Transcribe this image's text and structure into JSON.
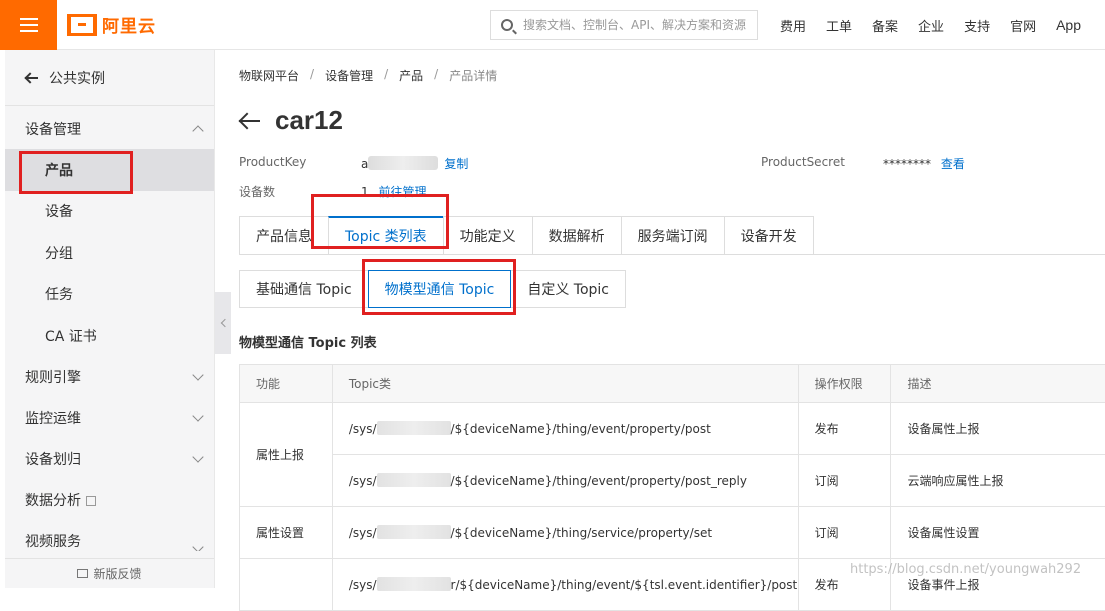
{
  "header": {
    "logo_text": "阿里云",
    "search_placeholder": "搜索文档、控制台、API、解决方案和资源",
    "nav": [
      "费用",
      "工单",
      "备案",
      "企业",
      "支持",
      "官网",
      "App"
    ]
  },
  "sidebar": {
    "back_label": "公共实例",
    "group_device": "设备管理",
    "sub_items": [
      "产品",
      "设备",
      "分组",
      "任务",
      "CA 证书"
    ],
    "groups": [
      "规则引擎",
      "监控运维",
      "设备划归"
    ],
    "data_analysis": "数据分析",
    "partial_item": "视频服务",
    "feedback": "新版反馈"
  },
  "breadcrumb": [
    "物联网平台",
    "设备管理",
    "产品",
    "产品详情"
  ],
  "product": {
    "title": "car12",
    "product_key_label": "ProductKey",
    "product_key_prefix": "a",
    "copy_link": "复制",
    "product_secret_label": "ProductSecret",
    "product_secret_value": "********",
    "view_link": "查看",
    "device_count_label": "设备数",
    "device_count_value": "1",
    "manage_link": "前往管理"
  },
  "tabs": [
    "产品信息",
    "Topic 类列表",
    "功能定义",
    "数据解析",
    "服务端订阅",
    "设备开发"
  ],
  "active_tab": "Topic 类列表",
  "subtabs": [
    "基础通信 Topic",
    "物模型通信 Topic",
    "自定义 Topic"
  ],
  "active_subtab": "物模型通信 Topic",
  "section_title": "物模型通信 Topic 列表",
  "table": {
    "columns": [
      "功能",
      "Topic类",
      "操作权限",
      "描述"
    ],
    "rows": [
      {
        "function": "属性上报",
        "topic_prefix": "/sys/",
        "topic_suffix": "/${deviceName}/thing/event/property/post",
        "permission": "发布",
        "description": "设备属性上报"
      },
      {
        "function": "",
        "topic_prefix": "/sys/",
        "topic_suffix": "/${deviceName}/thing/event/property/post_reply",
        "permission": "订阅",
        "description": "云端响应属性上报"
      },
      {
        "function": "属性设置",
        "topic_prefix": "/sys/",
        "topic_suffix": "/${deviceName}/thing/service/property/set",
        "permission": "订阅",
        "description": "设备属性设置"
      },
      {
        "function": "",
        "topic_prefix": "/sys/",
        "topic_suffix": "r/${deviceName}/thing/event/${tsl.event.identifier}/post",
        "permission": "发布",
        "description": "设备事件上报"
      }
    ]
  },
  "watermark": "https://blog.csdn.net/youngwah292",
  "colors": {
    "brand": "#ff6a00",
    "link": "#0070cc",
    "highlight": "#e02020"
  }
}
